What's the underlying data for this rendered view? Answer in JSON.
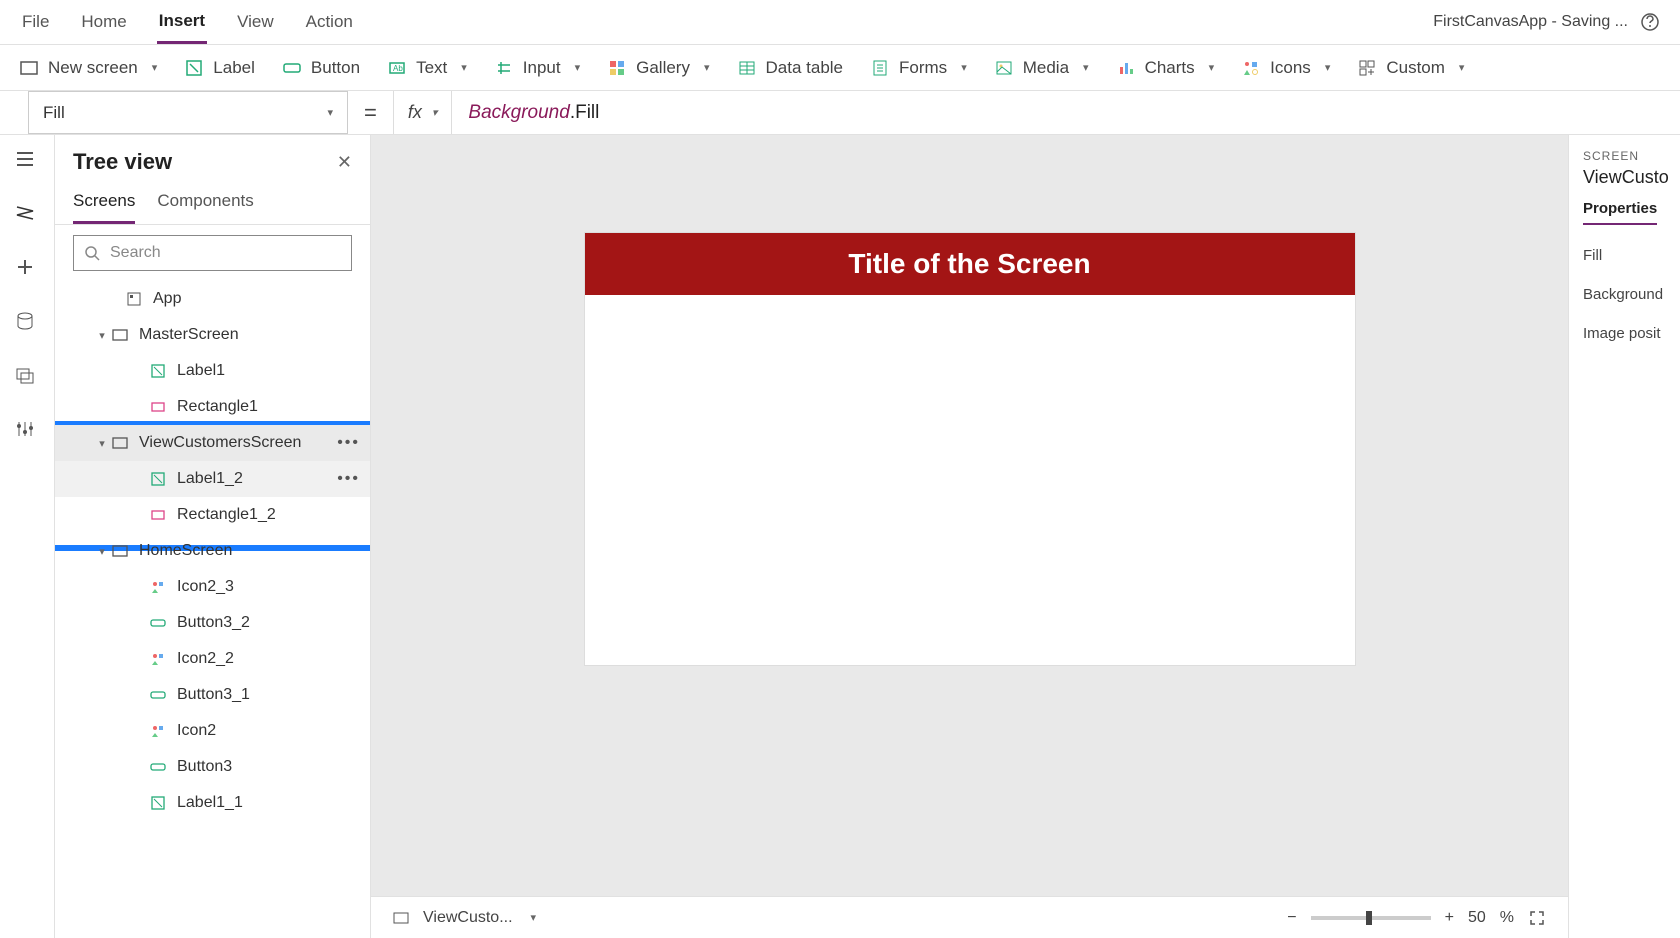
{
  "menubar": {
    "items": [
      "File",
      "Home",
      "Insert",
      "View",
      "Action"
    ],
    "active_index": 2,
    "app_status": "FirstCanvasApp - Saving ..."
  },
  "ribbon": {
    "new_screen": "New screen",
    "label": "Label",
    "button": "Button",
    "text": "Text",
    "input": "Input",
    "gallery": "Gallery",
    "data_table": "Data table",
    "forms": "Forms",
    "media": "Media",
    "charts": "Charts",
    "icons": "Icons",
    "custom": "Custom"
  },
  "formula": {
    "property": "Fill",
    "fx_label": "fx",
    "expr_obj": "Background",
    "expr_prop": ".Fill",
    "equals": "="
  },
  "tree": {
    "title": "Tree view",
    "tabs": [
      "Screens",
      "Components"
    ],
    "active_tab": 0,
    "search_placeholder": "Search",
    "nodes": [
      {
        "label": "App",
        "indent": 24,
        "icon": "app"
      },
      {
        "label": "MasterScreen",
        "indent": 10,
        "icon": "screen",
        "expander": "down"
      },
      {
        "label": "Label1",
        "indent": 48,
        "icon": "label"
      },
      {
        "label": "Rectangle1",
        "indent": 48,
        "icon": "rect"
      },
      {
        "label": "ViewCustomersScreen",
        "indent": 10,
        "icon": "screen",
        "expander": "down",
        "selected": true,
        "more": true
      },
      {
        "label": "Label1_2",
        "indent": 48,
        "icon": "label",
        "hover": true,
        "more": true
      },
      {
        "label": "Rectangle1_2",
        "indent": 48,
        "icon": "rect"
      },
      {
        "label": "HomeScreen",
        "indent": 10,
        "icon": "screen",
        "expander": "down"
      },
      {
        "label": "Icon2_3",
        "indent": 48,
        "icon": "iconctrl"
      },
      {
        "label": "Button3_2",
        "indent": 48,
        "icon": "button"
      },
      {
        "label": "Icon2_2",
        "indent": 48,
        "icon": "iconctrl"
      },
      {
        "label": "Button3_1",
        "indent": 48,
        "icon": "button"
      },
      {
        "label": "Icon2",
        "indent": 48,
        "icon": "iconctrl"
      },
      {
        "label": "Button3",
        "indent": 48,
        "icon": "button"
      },
      {
        "label": "Label1_1",
        "indent": 48,
        "icon": "label"
      }
    ]
  },
  "canvas": {
    "screen_title": "Title of the Screen",
    "status_screen": "ViewCusto...",
    "zoom_pct": "50",
    "pct_sign": "%",
    "minus": "−",
    "plus": "+"
  },
  "properties": {
    "caption": "SCREEN",
    "name": "ViewCusto",
    "tab": "Properties",
    "p1": "Fill",
    "p2": "Background",
    "p3": "Image posit"
  }
}
